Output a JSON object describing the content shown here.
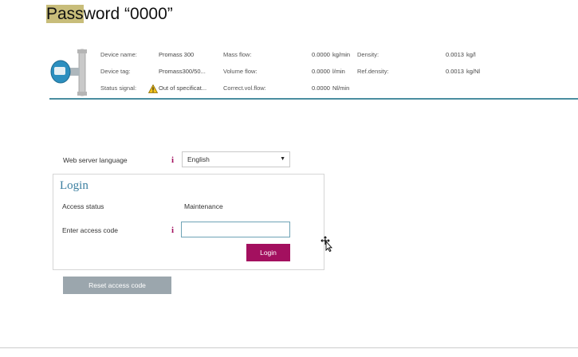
{
  "title": {
    "highlight": "Pass",
    "rest": "word “0000”"
  },
  "device_info": {
    "device_name_label": "Device name:",
    "device_name_value": "Promass 300",
    "device_tag_label": "Device tag:",
    "device_tag_value": "Promass300/50...",
    "status_signal_label": "Status signal:",
    "status_signal_value": "Out of specificat...",
    "mass_flow_label": "Mass flow:",
    "mass_flow_value": "0.0000",
    "mass_flow_unit": "kg/min",
    "volume_flow_label": "Volume flow:",
    "volume_flow_value": "0.0000",
    "volume_flow_unit": "l/min",
    "corr_vol_flow_label": "Correct.vol.flow:",
    "corr_vol_flow_value": "0.0000",
    "corr_vol_flow_unit": "Nl/min",
    "density_label": "Density:",
    "density_value": "0.0013",
    "density_unit": "kg/l",
    "ref_density_label": "Ref.density:",
    "ref_density_value": "0.0013",
    "ref_density_unit": "kg/Nl"
  },
  "language": {
    "label": "Web server language",
    "selected": "English"
  },
  "login": {
    "title": "Login",
    "access_status_label": "Access status",
    "access_status_value": "Maintenance",
    "access_code_label": "Enter access code",
    "access_code_value": "",
    "login_button": "Login",
    "reset_button": "Reset access code"
  },
  "icons": {
    "info": "info-icon",
    "warning": "warning-icon",
    "device": "flowmeter-device-icon",
    "cursor": "move-cursor-icon"
  },
  "colors": {
    "accent": "#a3105f",
    "header_line": "#4a8da0",
    "login_title": "#3b7fa0",
    "reset_button": "#9ba6ad",
    "title_highlight": "#c8bd7a"
  }
}
